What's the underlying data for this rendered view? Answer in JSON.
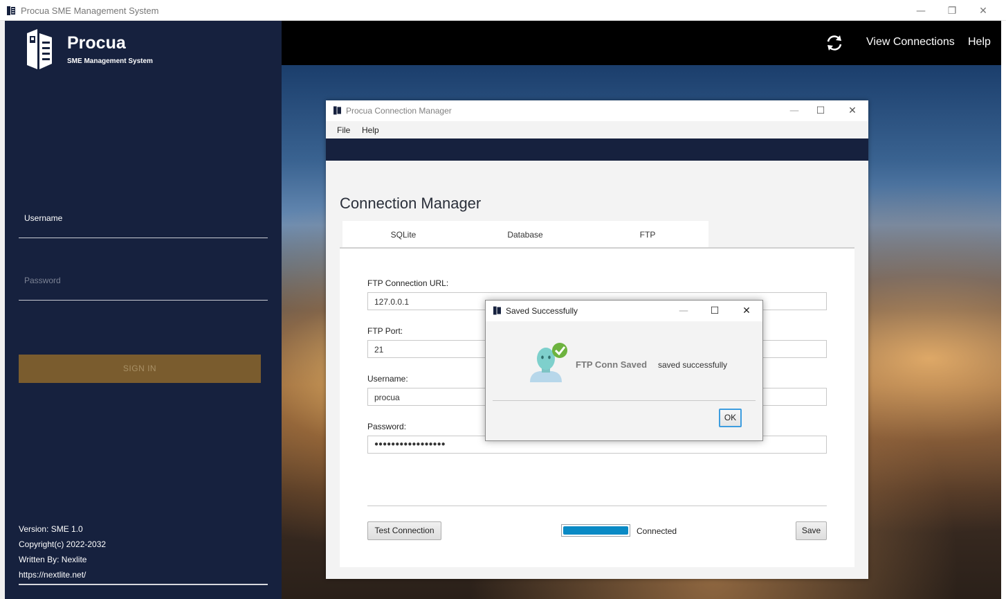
{
  "window": {
    "title": "Procua SME Management System",
    "minimize_glyph": "—",
    "restore_glyph": "❐",
    "close_glyph": "✕"
  },
  "sidebar": {
    "brand": "Procua",
    "tagline": "SME Management System",
    "username_label": "Username",
    "password_placeholder": "Password",
    "signin_label": "SIGN IN",
    "footer": {
      "version": "Version: SME 1.0",
      "copyright": "Copyright(c) 2022-2032",
      "author": "Written By: Nexlite",
      "url": "https://nextlite.net/"
    }
  },
  "topbar": {
    "refresh_icon": "refresh-icon",
    "view_connections": "View Connections",
    "help": "Help"
  },
  "connection_manager": {
    "window_title": "Procua Connection Manager",
    "menu": [
      "File",
      "Help"
    ],
    "heading": "Connection Manager",
    "tabs": [
      "SQLite",
      "Database",
      "FTP"
    ],
    "active_tab": "FTP",
    "fields": {
      "url_label": "FTP Connection URL:",
      "url_value": "127.0.0.1",
      "port_label": "FTP Port:",
      "port_value": "21",
      "username_label": "Username:",
      "username_value": "procua",
      "password_label": "Password:",
      "password_value": "●●●●●●●●●●●●●●●●●"
    },
    "test_button": "Test Connection",
    "progress_percent": 100,
    "status": "Connected",
    "save_button": "Save"
  },
  "dialog": {
    "title": "Saved Successfully",
    "heading": "FTP Conn Saved",
    "message": "saved successfully",
    "ok": "OK",
    "minimize_glyph": "—",
    "maximize_glyph": "☐",
    "close_glyph": "✕"
  },
  "colors": {
    "sidebar_bg": "#16213e",
    "signin_bg": "#7a5c2e",
    "progress_fill": "#0a8ac5",
    "ok_focus": "#3d9ddf"
  }
}
